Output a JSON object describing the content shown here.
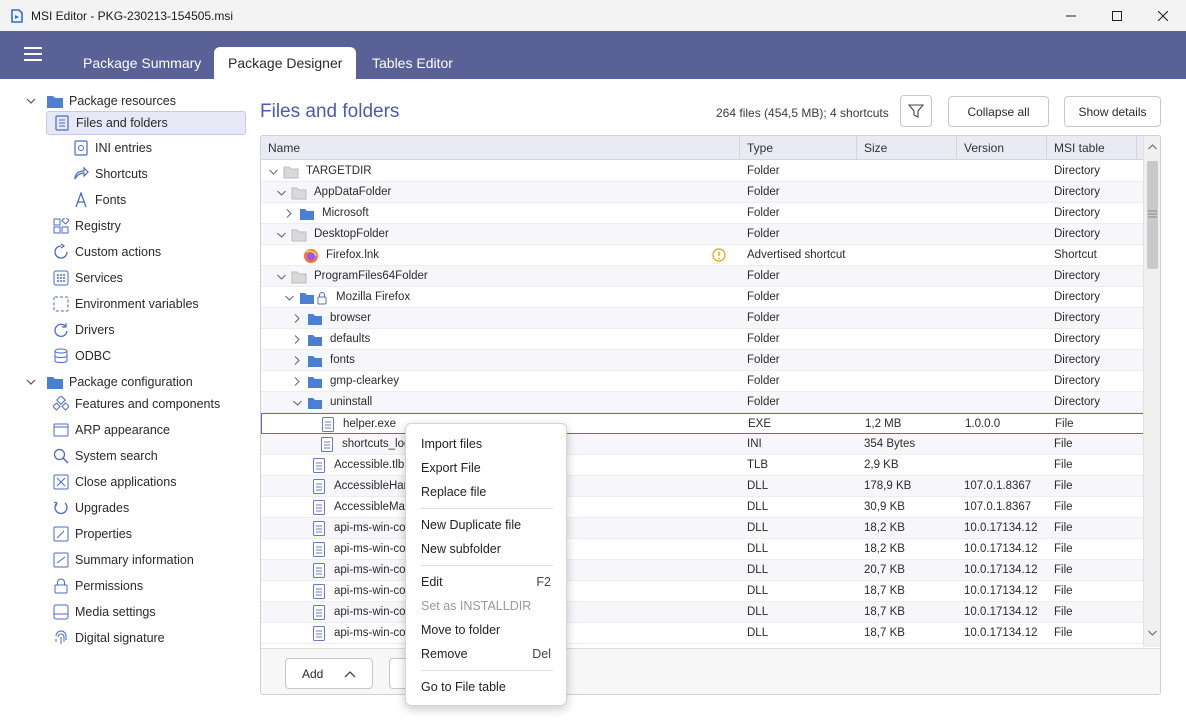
{
  "window": {
    "title": "MSI Editor - PKG-230213-154505.msi"
  },
  "tabs": [
    {
      "label": "Package Summary"
    },
    {
      "label": "Package Designer"
    },
    {
      "label": "Tables Editor"
    }
  ],
  "sidebar": {
    "groups": [
      {
        "label": "Package resources"
      },
      {
        "label": "Package configuration"
      }
    ],
    "items": [
      {
        "label": "Files and folders"
      },
      {
        "label": "INI entries"
      },
      {
        "label": "Shortcuts"
      },
      {
        "label": "Fonts"
      },
      {
        "label": "Registry"
      },
      {
        "label": "Custom actions"
      },
      {
        "label": "Services"
      },
      {
        "label": "Environment variables"
      },
      {
        "label": "Drivers"
      },
      {
        "label": "ODBC"
      },
      {
        "label": "Features and components"
      },
      {
        "label": "ARP appearance"
      },
      {
        "label": "System search"
      },
      {
        "label": "Close applications"
      },
      {
        "label": "Upgrades"
      },
      {
        "label": "Properties"
      },
      {
        "label": "Summary information"
      },
      {
        "label": "Permissions"
      },
      {
        "label": "Media settings"
      },
      {
        "label": "Digital signature"
      }
    ]
  },
  "main": {
    "title": "Files and folders",
    "stats": "264 files (454,5 MB); 4 shortcuts",
    "collapse_all": "Collapse all",
    "show_details": "Show details",
    "add_label": "Add"
  },
  "grid": {
    "columns": [
      {
        "label": "Name"
      },
      {
        "label": "Type"
      },
      {
        "label": "Size"
      },
      {
        "label": "Version"
      },
      {
        "label": "MSI table"
      }
    ],
    "rows": [
      {
        "name": "TARGETDIR",
        "type": "Folder",
        "size": "",
        "version": "",
        "table": "Directory"
      },
      {
        "name": "AppDataFolder",
        "type": "Folder",
        "size": "",
        "version": "",
        "table": "Directory"
      },
      {
        "name": "Microsoft",
        "type": "Folder",
        "size": "",
        "version": "",
        "table": "Directory"
      },
      {
        "name": "DesktopFolder",
        "type": "Folder",
        "size": "",
        "version": "",
        "table": "Directory"
      },
      {
        "name": "Firefox.lnk",
        "type": "Advertised shortcut",
        "size": "",
        "version": "",
        "table": "Shortcut"
      },
      {
        "name": "ProgramFiles64Folder",
        "type": "Folder",
        "size": "",
        "version": "",
        "table": "Directory"
      },
      {
        "name": "Mozilla Firefox",
        "type": "Folder",
        "size": "",
        "version": "",
        "table": "Directory"
      },
      {
        "name": "browser",
        "type": "Folder",
        "size": "",
        "version": "",
        "table": "Directory"
      },
      {
        "name": "defaults",
        "type": "Folder",
        "size": "",
        "version": "",
        "table": "Directory"
      },
      {
        "name": "fonts",
        "type": "Folder",
        "size": "",
        "version": "",
        "table": "Directory"
      },
      {
        "name": "gmp-clearkey",
        "type": "Folder",
        "size": "",
        "version": "",
        "table": "Directory"
      },
      {
        "name": "uninstall",
        "type": "Folder",
        "size": "",
        "version": "",
        "table": "Directory"
      },
      {
        "name": "helper.exe",
        "type": "EXE",
        "size": "1,2 MB",
        "version": "1.0.0.0",
        "table": "File"
      },
      {
        "name": "shortcuts_log",
        "type": "INI",
        "size": "354 Bytes",
        "version": "",
        "table": "File"
      },
      {
        "name": "Accessible.tlb",
        "type": "TLB",
        "size": "2,9 KB",
        "version": "",
        "table": "File"
      },
      {
        "name": "AccessibleHandler",
        "type": "DLL",
        "size": "178,9 KB",
        "version": "107.0.1.8367",
        "table": "File"
      },
      {
        "name": "AccessibleMarshal",
        "type": "DLL",
        "size": "30,9 KB",
        "version": "107.0.1.8367",
        "table": "File"
      },
      {
        "name": "api-ms-win-core",
        "type": "DLL",
        "size": "18,2 KB",
        "version": "10.0.17134.12",
        "table": "File"
      },
      {
        "name": "api-ms-win-core",
        "type": "DLL",
        "size": "18,2 KB",
        "version": "10.0.17134.12",
        "table": "File"
      },
      {
        "name": "api-ms-win-core",
        "type": "DLL",
        "size": "20,7 KB",
        "version": "10.0.17134.12",
        "table": "File"
      },
      {
        "name": "api-ms-win-core",
        "type": "DLL",
        "size": "18,7 KB",
        "version": "10.0.17134.12",
        "table": "File"
      },
      {
        "name": "api-ms-win-core",
        "type": "DLL",
        "size": "18,7 KB",
        "version": "10.0.17134.12",
        "table": "File"
      },
      {
        "name": "api-ms-win-core",
        "type": "DLL",
        "size": "18,7 KB",
        "version": "10.0.17134.12",
        "table": "File"
      }
    ]
  },
  "context_menu": {
    "items": [
      {
        "label": "Import files",
        "shortcut": ""
      },
      {
        "label": "Export File",
        "shortcut": ""
      },
      {
        "label": "Replace file",
        "shortcut": ""
      },
      {
        "label": "New Duplicate file",
        "shortcut": ""
      },
      {
        "label": "New subfolder",
        "shortcut": ""
      },
      {
        "label": "Edit",
        "shortcut": "F2"
      },
      {
        "label": "Set as INSTALLDIR",
        "shortcut": ""
      },
      {
        "label": "Move to folder",
        "shortcut": ""
      },
      {
        "label": "Remove",
        "shortcut": "Del"
      },
      {
        "label": "Go to File table",
        "shortcut": ""
      }
    ]
  },
  "colors": {
    "accent": "#5a6196",
    "title_blue": "#4b5bb3",
    "folder_blue": "#4a7fd4"
  }
}
